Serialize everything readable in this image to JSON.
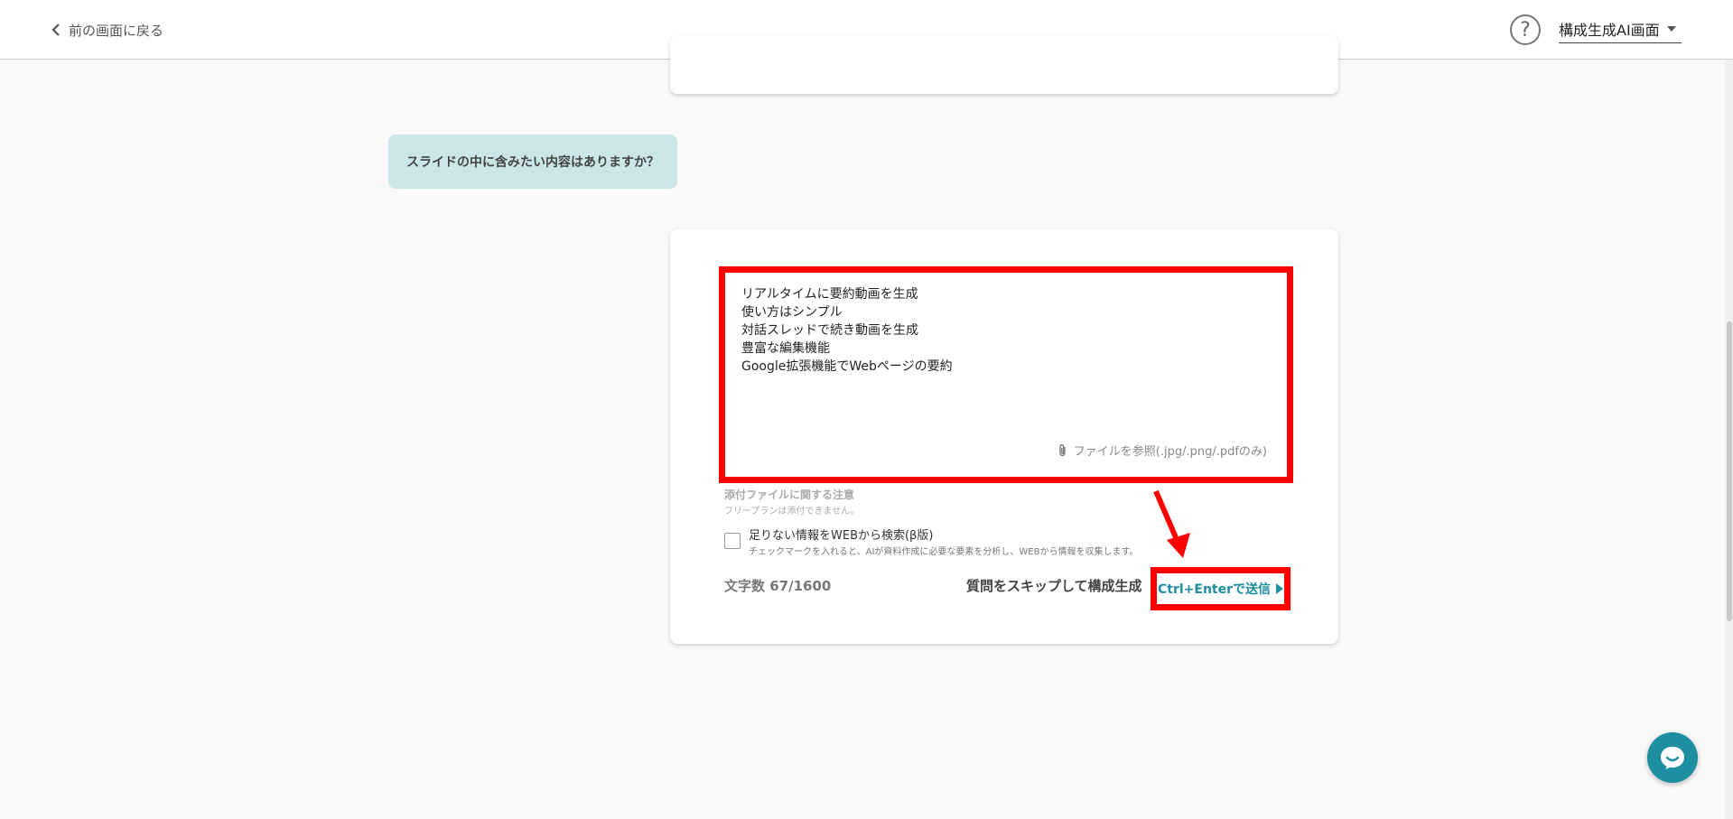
{
  "header": {
    "back_label": "前の画面に戻る",
    "help_icon_glyph": "?",
    "mode_select_value": "構成生成AI画面"
  },
  "question": {
    "text": "スライドの中に含みたい内容はありますか？"
  },
  "answer": {
    "lines": [
      "リアルタイムに要約動画を生成",
      "使い方はシンプル",
      "対話スレッドで続き動画を生成",
      "豊富な編集機能",
      "Google拡張機能でWebページの要約"
    ],
    "file_link": "ファイルを参照(.jpg/.png/.pdfのみ)",
    "attach_note_title": "添付ファイルに関する注意",
    "attach_note_sub": "フリープランは添付できません。",
    "web_search_label": "足りない情報をWEBから検索(β版)",
    "web_search_desc": "チェックマークを入れると、AIが資料作成に必要な要素を分析し、WEBから情報を収集します。",
    "web_search_checked": false,
    "char_count": "文字数 67/1600",
    "skip_label": "質問をスキップして構成生成",
    "send_label": "Ctrl+Enterで送信"
  },
  "colors": {
    "accent": "#1d8fa0",
    "question_bubble": "#cce6e8",
    "annotation": "#ff0000"
  },
  "icons": [
    "chevron-left-icon",
    "help-circle-icon",
    "caret-down-icon",
    "paperclip-icon",
    "play-icon",
    "chat-icon"
  ]
}
